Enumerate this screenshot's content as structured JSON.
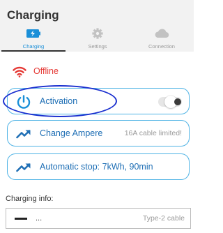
{
  "app": {
    "title": "Charging"
  },
  "tabs": [
    {
      "label": "Charging",
      "icon": "battery-charging-icon",
      "active": true
    },
    {
      "label": "Settings",
      "icon": "gear-icon",
      "active": false
    },
    {
      "label": "Connection",
      "icon": "cloud-icon",
      "active": false
    }
  ],
  "status": {
    "text": "Offline",
    "icon": "wifi-icon",
    "color": "#e53935"
  },
  "cards": {
    "activation": {
      "label": "Activation",
      "icon": "power-icon",
      "toggle_on": false
    },
    "change_ampere": {
      "label": "Change Ampere",
      "hint": "16A cable limited!",
      "icon": "trend-up-icon"
    },
    "auto_stop": {
      "label": "Automatic stop: 7kWh, 90min",
      "icon": "trend-up-icon"
    }
  },
  "charging_info": {
    "title": "Charging info:",
    "value": "...",
    "type": "Type-2 cable"
  },
  "colors": {
    "accent": "#1a8fd8",
    "card_border": "#4fb3e5",
    "card_text": "#1f6fb5",
    "header_bg": "#f2f2f2",
    "annotation": "#1a2fcf"
  }
}
